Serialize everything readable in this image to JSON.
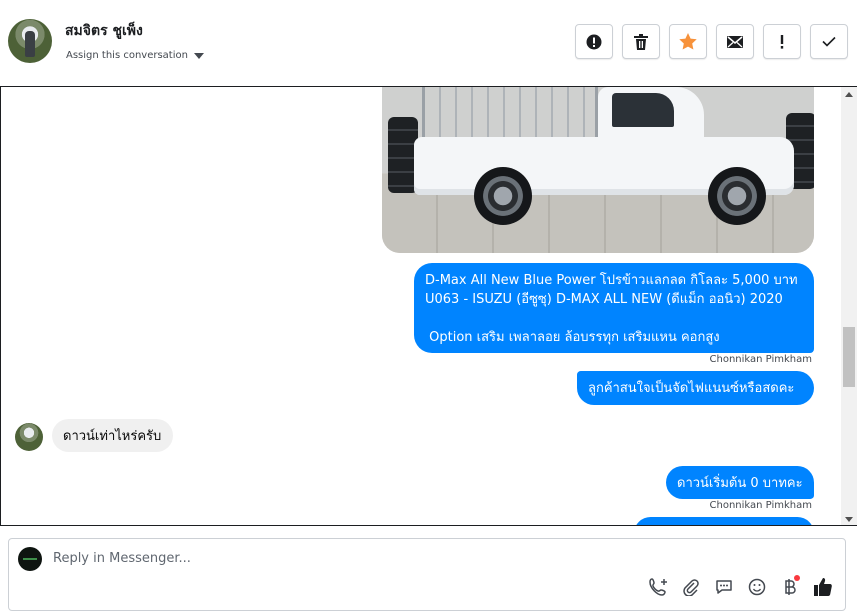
{
  "header": {
    "contact_name": "สมจิตร ชูเพ็ง",
    "assign_label": "Assign this conversation",
    "toolbar": [
      {
        "icon": "alert-circle-icon"
      },
      {
        "icon": "trash-icon"
      },
      {
        "icon": "star-icon",
        "color": "#f7923b"
      },
      {
        "icon": "envelope-icon"
      },
      {
        "icon": "exclamation-icon"
      },
      {
        "icon": "check-icon"
      }
    ]
  },
  "thread": {
    "messages": [
      {
        "type": "image",
        "direction": "outgoing",
        "subject": "white Isuzu D-Max pickup"
      },
      {
        "type": "text",
        "direction": "outgoing",
        "text": "D-Max All New Blue Power โปรข้าวแลกลด กิโลละ 5,000 บาท\nU063 - ISUZU (อีซูซุ) D-MAX ALL NEW (ดีแม็ก ออนิว) 2020\n\n Option เสริม เพลาลอย ล้อบรรทุก เสริมแหน คอกสูง"
      },
      {
        "type": "sender",
        "text": "Chonnikan Pimkham"
      },
      {
        "type": "text",
        "direction": "outgoing",
        "text": "ลูกค้าสนใจเป็นจัดไฟแนนซ์หรือสดคะ"
      },
      {
        "type": "text",
        "direction": "incoming",
        "text": "ดาวน์เท่าไหร่ครับ"
      },
      {
        "type": "text",
        "direction": "outgoing",
        "text": "ดาวน์เริ่มต้น 0 บาทคะ"
      },
      {
        "type": "sender",
        "text": "Chonnikan Pimkham"
      }
    ]
  },
  "composer": {
    "placeholder": "Reply in Messenger...",
    "tools": [
      "phone-plus-icon",
      "paperclip-icon",
      "saved-reply-icon",
      "emoji-icon",
      "baht-icon",
      "thumbs-up-icon"
    ]
  },
  "colors": {
    "accent": "#0084ff",
    "incoming_bubble": "#f0f0f0",
    "star": "#f7923b"
  }
}
